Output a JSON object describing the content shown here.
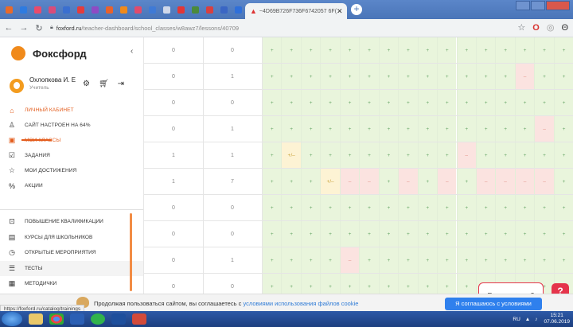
{
  "browser": {
    "active_tab_title": "~4D69B726F736F6742057 6F(",
    "url_host": "foxford.ru",
    "url_path": "/teacher-dashboard/school_classes/w8awz7/lessons/40709"
  },
  "sidebar": {
    "logo": "Фоксфорд",
    "user_name": "Охлопкова И. Е",
    "user_role": "Учитель",
    "items": [
      {
        "label": "ЛИЧНЫЙ КАБИНЕТ",
        "icon": "house-icon",
        "glyph": "⌂",
        "accent": true
      },
      {
        "label": "САЙТ НАСТРОЕН НА 64%",
        "icon": "person-icon",
        "glyph": "♙",
        "accent": false
      },
      {
        "label": "МОИ КЛАССЫ",
        "icon": "class-icon",
        "glyph": "▣",
        "accent": true
      },
      {
        "label": "ЗАДАНИЯ",
        "icon": "checklist-icon",
        "glyph": "☑",
        "accent": false
      },
      {
        "label": "МОИ ДОСТИЖЕНИЯ",
        "icon": "star-icon",
        "glyph": "☆",
        "accent": false
      },
      {
        "label": "АКЦИИ",
        "icon": "percent-icon",
        "glyph": "%",
        "accent": false
      }
    ],
    "items2": [
      {
        "label": "ПОВЫШЕНИЕ КВАЛИФИКАЦИИ",
        "icon": "plus-box-icon",
        "glyph": "⊡"
      },
      {
        "label": "КУРСЫ ДЛЯ ШКОЛЬНИКОВ",
        "icon": "book-icon",
        "glyph": "▤"
      },
      {
        "label": "ОТКРЫТЫЕ МЕРОПРИЯТИЯ",
        "icon": "clock-icon",
        "glyph": "◷"
      },
      {
        "label": "ТЕСТЫ",
        "icon": "list-icon",
        "glyph": "☰"
      },
      {
        "label": "МЕТОДИЧКИ",
        "icon": "doc-icon",
        "glyph": "▦"
      }
    ],
    "site_setup_percent": 64
  },
  "table": {
    "rows": [
      {
        "a": "0",
        "b": "0",
        "cells": "gggggggggggggggg"
      },
      {
        "a": "0",
        "b": "1",
        "cells": "gggggggggggggrgg"
      },
      {
        "a": "0",
        "b": "0",
        "cells": "gggggggggggggggg"
      },
      {
        "a": "0",
        "b": "1",
        "cells": "ggggggggggggggrg"
      },
      {
        "a": "1",
        "b": "1",
        "cells": "gyggggggggrggggg"
      },
      {
        "a": "1",
        "b": "7",
        "cells": "gggyrrgrgrgrrrrg"
      },
      {
        "a": "0",
        "b": "0",
        "cells": "gggggggggggggggg"
      },
      {
        "a": "0",
        "b": "0",
        "cells": "gggggggggggggggg"
      },
      {
        "a": "0",
        "b": "1",
        "cells": "ggggrggggggggggg"
      },
      {
        "a": "0",
        "b": "0",
        "cells": "gggggggggggggggg"
      }
    ],
    "plus": "+",
    "minus": "–",
    "partial": "+/–"
  },
  "chat": {
    "label": "Есть вопросы?",
    "help": "?"
  },
  "cookie": {
    "text": "Продолжая пользоваться сайтом, вы соглашаетесь с",
    "link": "условиями использования файлов cookie",
    "accept": "Я соглашаюсь с условиями"
  },
  "status_url": "https://foxford.ru/catalog/trainings",
  "taskbar": {
    "lang": "RU",
    "time": "15:21",
    "date": "07.06.2019"
  }
}
